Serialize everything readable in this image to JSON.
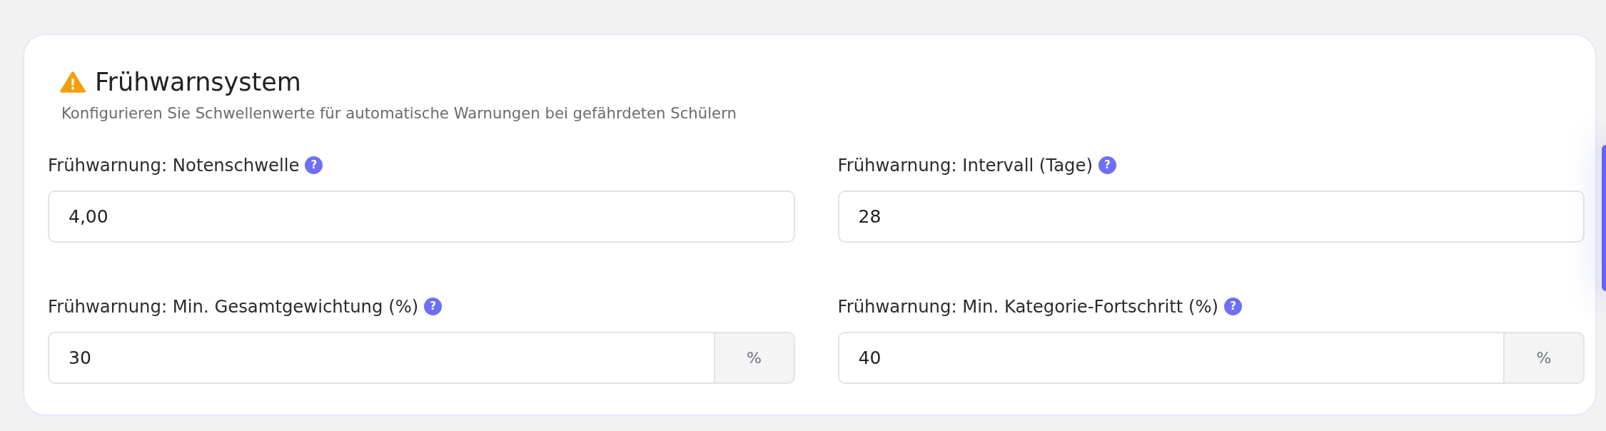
{
  "card": {
    "title": "Frühwarnsystem",
    "subtitle": "Konfigurieren Sie Schwellenwerte für automatische Warnungen bei gefährdeten Schülern"
  },
  "fields": [
    {
      "label": "Frühwarnung: Notenschwelle",
      "help": "?",
      "value": "4,00"
    },
    {
      "label": "Frühwarnung: Intervall (Tage)",
      "help": "?",
      "value": "28"
    },
    {
      "label": "Frühwarnung: Min. Gesamtgewichtung (%)",
      "help": "?",
      "value": "30",
      "suffix": "%"
    },
    {
      "label": "Frühwarnung: Min. Kategorie-Fortschritt (%)",
      "help": "?",
      "value": "40",
      "suffix": "%"
    }
  ]
}
